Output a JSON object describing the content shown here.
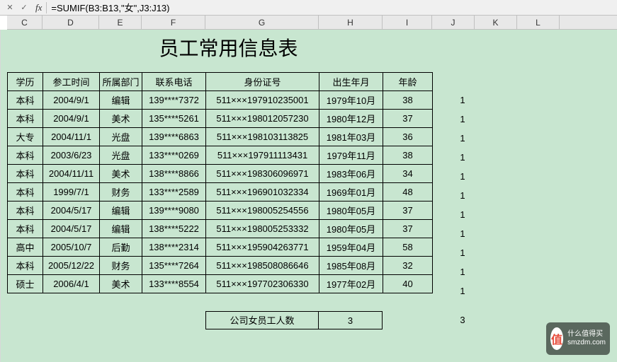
{
  "formula_bar": {
    "cancel": "✕",
    "confirm": "✓",
    "fx": "fx",
    "formula": "=SUMIF(B3:B13,\"女\",J3:J13)"
  },
  "columns": [
    "C",
    "D",
    "E",
    "F",
    "G",
    "H",
    "I",
    "J",
    "K",
    "L"
  ],
  "col_widths": {
    "C": 50,
    "D": 80,
    "E": 60,
    "F": 90,
    "G": 160,
    "H": 90,
    "I": 70,
    "J": 60,
    "K": 60,
    "L": 60
  },
  "title": "员工常用信息表",
  "headers": {
    "C": "学历",
    "D": "参工时间",
    "E": "所属部门",
    "F": "联系电话",
    "G": "身份证号",
    "H": "出生年月",
    "I": "年龄"
  },
  "rows": [
    {
      "C": "本科",
      "D": "2004/9/1",
      "E": "编辑",
      "F": "139****7372",
      "G": "511×××197910235001",
      "H": "1979年10月",
      "I": "38",
      "J": "1"
    },
    {
      "C": "本科",
      "D": "2004/9/1",
      "E": "美术",
      "F": "135****5261",
      "G": "511×××198012057230",
      "H": "1980年12月",
      "I": "37",
      "J": "1"
    },
    {
      "C": "大专",
      "D": "2004/11/1",
      "E": "光盘",
      "F": "139****6863",
      "G": "511×××198103113825",
      "H": "1981年03月",
      "I": "36",
      "J": "1"
    },
    {
      "C": "本科",
      "D": "2003/6/23",
      "E": "光盘",
      "F": "133****0269",
      "G": "511×××197911113431",
      "H": "1979年11月",
      "I": "38",
      "J": "1"
    },
    {
      "C": "本科",
      "D": "2004/11/11",
      "E": "美术",
      "F": "138****8866",
      "G": "511×××198306096971",
      "H": "1983年06月",
      "I": "34",
      "J": "1"
    },
    {
      "C": "本科",
      "D": "1999/7/1",
      "E": "财务",
      "F": "133****2589",
      "G": "511×××196901032334",
      "H": "1969年01月",
      "I": "48",
      "J": "1"
    },
    {
      "C": "本科",
      "D": "2004/5/17",
      "E": "编辑",
      "F": "139****9080",
      "G": "511×××198005254556",
      "H": "1980年05月",
      "I": "37",
      "J": "1"
    },
    {
      "C": "本科",
      "D": "2004/5/17",
      "E": "编辑",
      "F": "138****5222",
      "G": "511×××198005253332",
      "H": "1980年05月",
      "I": "37",
      "J": "1"
    },
    {
      "C": "高中",
      "D": "2005/10/7",
      "E": "后勤",
      "F": "138****2314",
      "G": "511×××195904263771",
      "H": "1959年04月",
      "I": "58",
      "J": "1"
    },
    {
      "C": "本科",
      "D": "2005/12/22",
      "E": "财务",
      "F": "135****7264",
      "G": "511×××198508086646",
      "H": "1985年08月",
      "I": "32",
      "J": "1"
    },
    {
      "C": "硕士",
      "D": "2006/4/1",
      "E": "美术",
      "F": "133****8554",
      "G": "511×××197702306330",
      "H": "1977年02月",
      "I": "40",
      "J": "1"
    }
  ],
  "summary": {
    "label": "公司女员工人数",
    "value": "3",
    "formula_result": "3"
  },
  "watermark": {
    "badge": "值",
    "line1": "什么值得买",
    "line2": "smzdm.com"
  }
}
